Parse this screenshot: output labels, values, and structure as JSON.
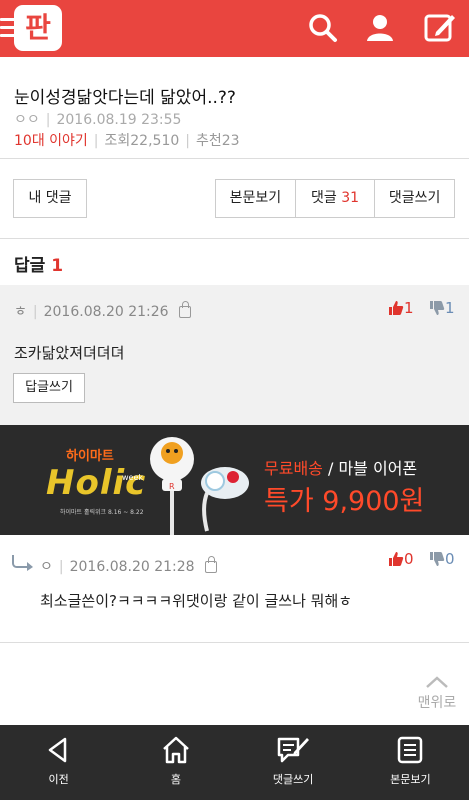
{
  "header": {
    "logo_text": "판",
    "brand_color": "#e9453f",
    "icons": [
      "menu-icon",
      "search-icon",
      "user-icon",
      "write-icon"
    ]
  },
  "post": {
    "title": "눈이성경닮앗다는데 닮았어..??",
    "author": "ㅇㅇ",
    "date": "2016.08.19 23:55",
    "category": "10대 이야기",
    "views_label": "조회22,510",
    "recommend_label": "추천23"
  },
  "buttons": {
    "my_comments": "내 댓글",
    "view_post": "본문보기",
    "comments_label": "댓글",
    "comments_count": "31",
    "write_comment": "댓글쓰기"
  },
  "replies_section": {
    "label": "답글",
    "count": "1"
  },
  "comment": {
    "author": "ㅎ",
    "date": "2016.08.20 21:26",
    "text": "조카닮았져뎌뎌뎌",
    "reply_button": "답글쓰기",
    "likes": "1",
    "dislikes": "1"
  },
  "ad": {
    "brand": "하이마트",
    "holic": "Holic",
    "week": "week",
    "period": "하이마트 홀릭위크 8.16 ~ 8.22",
    "line1_highlight": "무료배송",
    "line1_rest": " / 마블 이어폰",
    "line2": "특가 9,900원"
  },
  "reply": {
    "author": "ㅇ",
    "date": "2016.08.20 21:28",
    "text": "최소글쓴이?ㅋㅋㅋㅋ위댓이랑 같이 글쓰나 뭐해ㅎ",
    "likes": "0",
    "dislikes": "0"
  },
  "to_top": "맨위로",
  "bottom_nav": {
    "back": "이전",
    "home": "홈",
    "write_comment": "댓글쓰기",
    "view_post": "본문보기"
  }
}
